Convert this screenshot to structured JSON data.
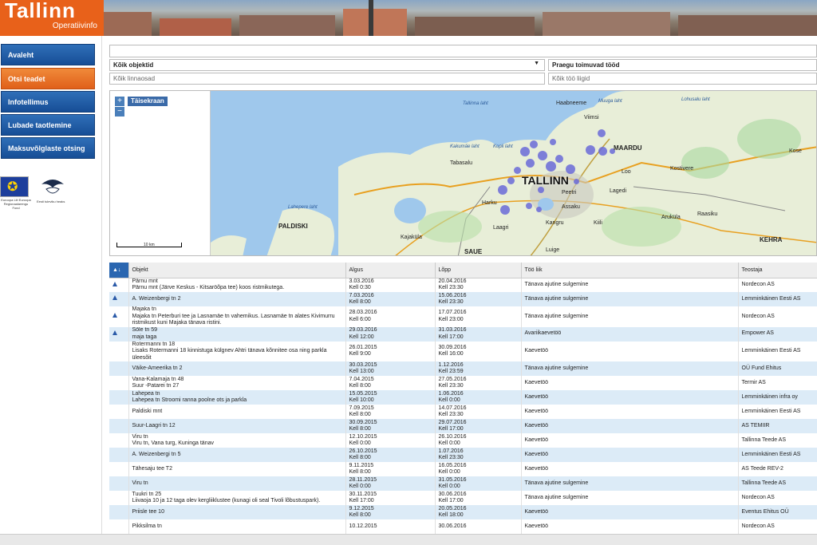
{
  "header": {
    "logo_name": "Tallinn",
    "logo_sub": "Operatiivinfo"
  },
  "sidebar": {
    "items": [
      {
        "label": "Avaleht"
      },
      {
        "label": "Otsi teadet"
      },
      {
        "label": "Infotellimus"
      },
      {
        "label": "Lubade taotlemine"
      },
      {
        "label": "Maksuvõlglaste otsing"
      }
    ],
    "eu_caption": "Euroopa Liit Euroopa Regionaalarengu Fond",
    "est_caption": "Eesti tuleviku heaks"
  },
  "filters": {
    "search_value": "",
    "object_select": "Kõik objektid",
    "time_select": "Praegu toimuvad tööd",
    "district_value": "Kõik linnaosad",
    "worktype_value": "Kõik töö liigid"
  },
  "map": {
    "fullscreen_label": "Täisekraan",
    "zoom_in": "+",
    "zoom_out": "−",
    "scale_label": "10 km",
    "labels": [
      {
        "text": "TALLINN",
        "cls": "huge"
      },
      {
        "text": "MAARDU",
        "cls": "big"
      },
      {
        "text": "PALDISKI",
        "cls": "big"
      },
      {
        "text": "SAUE",
        "cls": "big"
      },
      {
        "text": "KEHRA",
        "cls": "big"
      },
      {
        "text": "Tallinna laht",
        "cls": "sea"
      },
      {
        "text": "Muuga laht",
        "cls": "sea"
      },
      {
        "text": "Kakumäe laht",
        "cls": "sea"
      },
      {
        "text": "Kopli laht",
        "cls": "sea"
      },
      {
        "text": "Lohusalu laht",
        "cls": "sea"
      },
      {
        "text": "Lahepere laht",
        "cls": "sea"
      },
      {
        "text": "Tabasalu",
        "cls": ""
      },
      {
        "text": "Harku",
        "cls": ""
      },
      {
        "text": "Laagri",
        "cls": ""
      },
      {
        "text": "Peetri",
        "cls": ""
      },
      {
        "text": "Assaku",
        "cls": ""
      },
      {
        "text": "Kangru",
        "cls": ""
      },
      {
        "text": "Loo",
        "cls": ""
      },
      {
        "text": "Lagedi",
        "cls": ""
      },
      {
        "text": "Kostivere",
        "cls": ""
      },
      {
        "text": "Aruküla",
        "cls": ""
      },
      {
        "text": "Raasiku",
        "cls": ""
      },
      {
        "text": "Kiili",
        "cls": ""
      },
      {
        "text": "Luige",
        "cls": ""
      },
      {
        "text": "Kajaküla",
        "cls": ""
      },
      {
        "text": "Haabneeme",
        "cls": ""
      },
      {
        "text": "Viimsi",
        "cls": ""
      },
      {
        "text": "Kose",
        "cls": ""
      }
    ]
  },
  "table": {
    "headers": [
      "",
      "Objekt",
      "Algus",
      "Lõpp",
      "Töö liik",
      "Teostaja"
    ],
    "rows": [
      {
        "icon": true,
        "object": "Pärnu mnt\nPärnu mnt (Järve Keskus - Kitsaröõpa tee) koos ristmikutega.",
        "start": "3.03.2016\nKell 0:30",
        "end": "20.04.2016\nKell 23:30",
        "type": "Tänava ajutine sulgemine",
        "contractor": "Nordecon AS"
      },
      {
        "icon": true,
        "object": "A. Weizenbergi tn 2",
        "start": "7.03.2016\nKell 8:00",
        "end": "15.06.2016\nKell 23:30",
        "type": "Tänava ajutine sulgemine",
        "contractor": "Lemminkäinen Eesti AS"
      },
      {
        "icon": true,
        "object": "Majaka tn\nMajaka tn Peterburi tee ja Lasnamäe tn vahemikus. Lasnamäe tn alates Kivimurru ristmikust kuni Majaka tänava ristini.",
        "start": "28.03.2016\nKell 6:00",
        "end": "17.07.2016\nKell 23:00",
        "type": "Tänava ajutine sulgemine",
        "contractor": "Nordecon AS"
      },
      {
        "icon": true,
        "object": "Sõle tn 59\nmaja taga",
        "start": "29.03.2016\nKell 12:00",
        "end": "31.03.2016\nKell 17:00",
        "type": "Avariikaevetöö",
        "contractor": "Empower AS"
      },
      {
        "icon": false,
        "object": "Rotermanni tn 18\nLisaks Rotermanni 18 kinnistuga külgnev Ahtri tänava kõnnitee osa ning parkla üleesõit",
        "start": "26.01.2015\nKell 9:00",
        "end": "30.09.2016\nKell 16:00",
        "type": "Kaevetöö",
        "contractor": "Lemminkäinen Eesti AS"
      },
      {
        "icon": false,
        "object": "Väike-Ameerika tn 2",
        "start": "30.03.2015\nKell 13:00",
        "end": "1.12.2016\nKell 23:59",
        "type": "Tänava ajutine sulgemine",
        "contractor": "OÜ Fund Ehitus"
      },
      {
        "icon": false,
        "object": "Vana-Kalamaja tn 48\nSuur -Patarei tn 27",
        "start": "7.04.2015\nKell 8:00",
        "end": "27.05.2016\nKell 23:30",
        "type": "Kaevetöö",
        "contractor": "Termir AS"
      },
      {
        "icon": false,
        "object": "Lahepea tn\nLahepea tn Stroomi ranna poolne ots ja parkla",
        "start": "15.05.2015\nKell 10:00",
        "end": "1.06.2016\nKell 0:00",
        "type": "Kaevetöö",
        "contractor": "Lemminkäinen infra oy"
      },
      {
        "icon": false,
        "object": "Paldiski mnt",
        "start": "7.09.2015\nKell 8:00",
        "end": "14.07.2016\nKell 23:30",
        "type": "Kaevetöö",
        "contractor": "Lemminkäinen Eesti AS"
      },
      {
        "icon": false,
        "object": "Suur-Laagri tn 12",
        "start": "30.09.2015\nKell 8:00",
        "end": "29.07.2016\nKell 17:00",
        "type": "Kaevetöö",
        "contractor": "AS TEMIIR"
      },
      {
        "icon": false,
        "object": "Viru tn\nViru tn, Vana turg, Kuninga tänav",
        "start": "12.10.2015\nKell 0:00",
        "end": "26.10.2016\nKell 0:00",
        "type": "Kaevetöö",
        "contractor": "Tallinna Teede AS"
      },
      {
        "icon": false,
        "object": "A. Weizenbergi tn 5",
        "start": "26.10.2015\nKell 8:00",
        "end": "1.07.2016\nKell 23:30",
        "type": "Kaevetöö",
        "contractor": "Lemminkäinen Eesti AS"
      },
      {
        "icon": false,
        "object": "Tähesaju tee T2",
        "start": "9.11.2015\nKell 8:00",
        "end": "16.05.2016\nKell 0:00",
        "type": "Kaevetöö",
        "contractor": "AS Teede REV-2"
      },
      {
        "icon": false,
        "object": "Viru tn",
        "start": "28.11.2015\nKell 0:00",
        "end": "31.05.2016\nKell 0:00",
        "type": "Tänava ajutine sulgemine",
        "contractor": "Tallinna Teede AS"
      },
      {
        "icon": false,
        "object": "Tuukri tn 25\nLiivaoja 10 ja 12 taga olev kergliiklustee (kunagi oli seal Tivoli lõbustuspark).",
        "start": "30.11.2015\nKell 17:00",
        "end": "30.06.2016\nKell 17:00",
        "type": "Tänava ajutine sulgemine",
        "contractor": "Nordecon AS"
      },
      {
        "icon": false,
        "object": "Priisle tee 10",
        "start": "9.12.2015\nKell 8:00",
        "end": "20.05.2016\nKell 18:00",
        "type": "Kaevetöö",
        "contractor": "Eventus Ehitus OÜ"
      },
      {
        "icon": false,
        "object": "Pikksilma tn",
        "start": "10.12.2015",
        "end": "30.06.2016",
        "type": "Kaevetöö",
        "contractor": "Nordecon AS"
      }
    ]
  }
}
